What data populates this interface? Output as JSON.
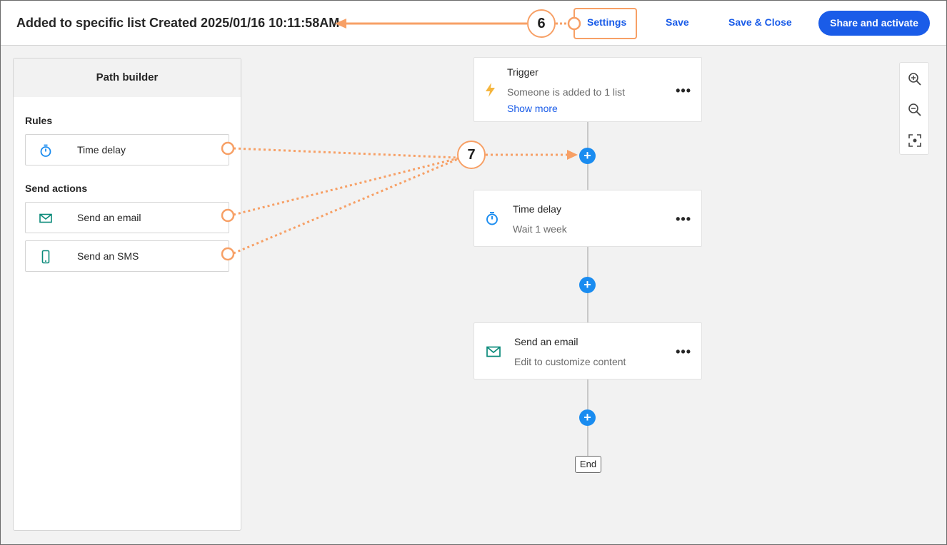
{
  "header": {
    "title": "Added to specific list Created 2025/01/16 10:11:58AM",
    "settings_label": "Settings",
    "save_label": "Save",
    "save_close_label": "Save & Close",
    "share_label": "Share and activate"
  },
  "sidebar": {
    "title": "Path builder",
    "rules_label": "Rules",
    "send_actions_label": "Send actions",
    "items": [
      {
        "label": "Time delay",
        "icon": "stopwatch-icon"
      },
      {
        "label": "Send an email",
        "icon": "envelope-icon"
      },
      {
        "label": "Send an SMS",
        "icon": "mobile-phone-icon"
      }
    ]
  },
  "flow": {
    "trigger": {
      "title": "Trigger",
      "subtitle": "Someone is added to 1 list",
      "link": "Show more",
      "icon": "lightning-icon"
    },
    "delay": {
      "title": "Time delay",
      "subtitle": "Wait 1 week",
      "icon": "stopwatch-icon"
    },
    "email": {
      "title": "Send an email",
      "subtitle": "Edit to customize content",
      "icon": "envelope-icon"
    },
    "menu_label": "•••",
    "add_label": "+",
    "end_label": "End"
  },
  "zoom": {
    "icons": [
      "zoom-in-icon",
      "zoom-out-icon",
      "fit-screen-icon"
    ]
  },
  "callouts": {
    "first": "6",
    "second": "7"
  },
  "colors": {
    "accent": "#1a5ce8",
    "plus": "#1a8cf0",
    "callout": "#f7a066",
    "teal": "#0a8a7a",
    "bolt": "#f5b53d"
  }
}
